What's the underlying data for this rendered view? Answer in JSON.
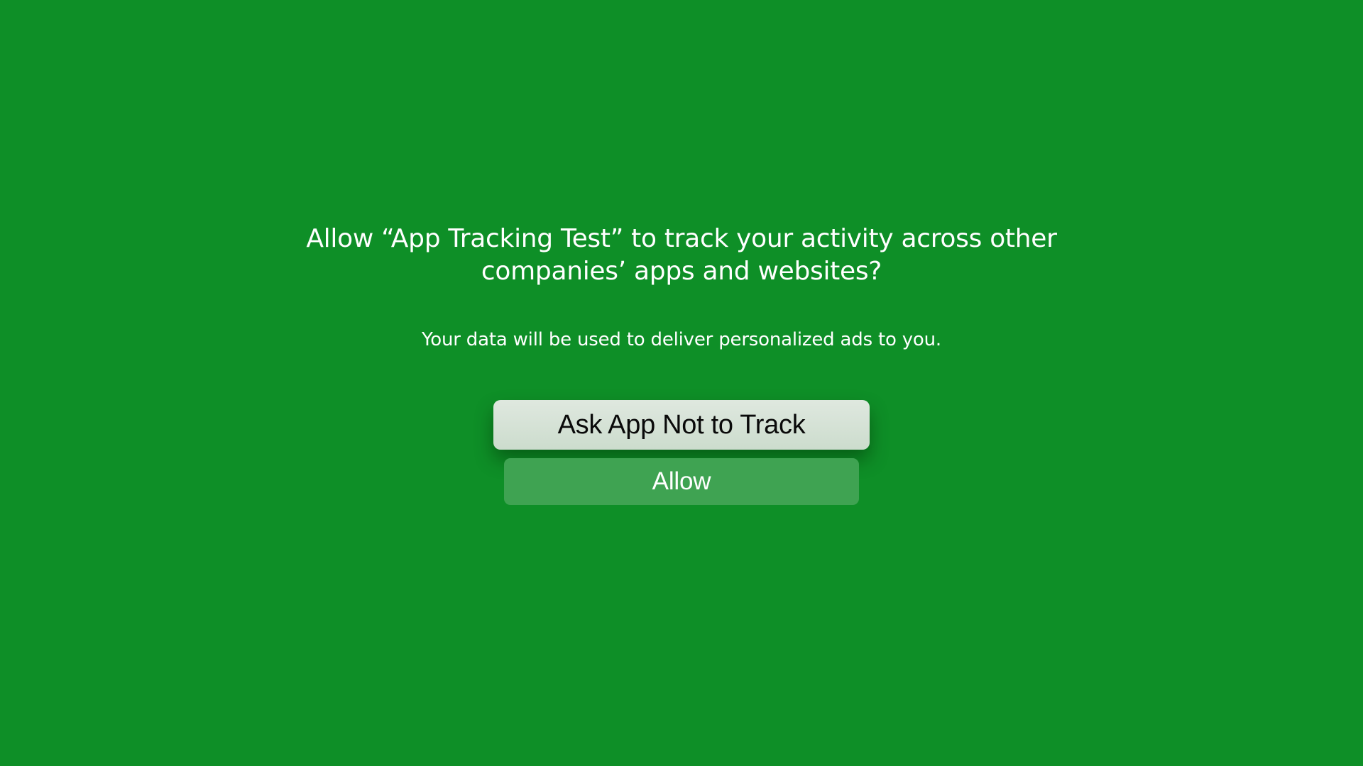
{
  "colors": {
    "background": "#0e8f27",
    "focused_button": "#d4e2d5",
    "button": "#3fa352",
    "text_light": "#ffffff",
    "text_dark": "#0a0a0a"
  },
  "alert": {
    "title": "Allow “App Tracking Test” to track your activity across other companies’ apps and websites?",
    "message": "Your data will be used to deliver personalized ads to you.",
    "buttons": [
      {
        "label": "Ask App Not to Track",
        "focused": true
      },
      {
        "label": "Allow",
        "focused": false
      }
    ]
  }
}
